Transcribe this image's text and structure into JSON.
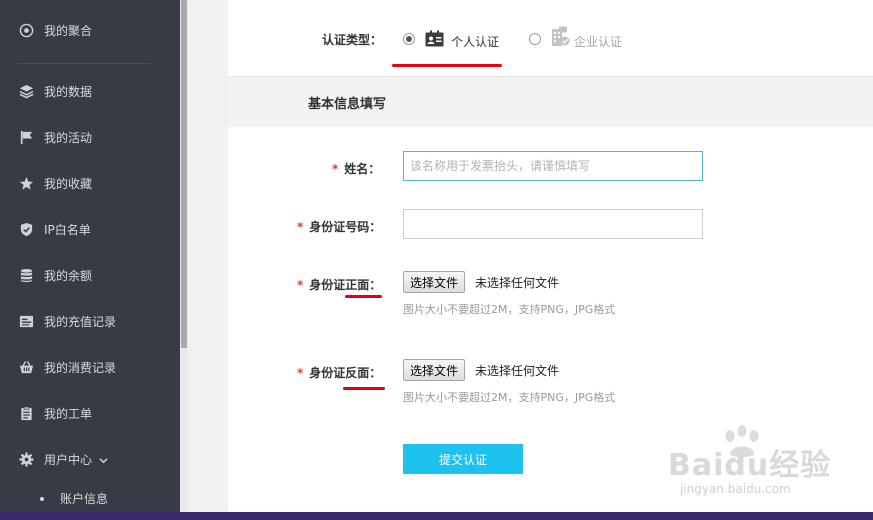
{
  "sidebar": {
    "items": [
      {
        "label": "我的聚合",
        "icon": "aggregate-icon"
      },
      {
        "label": "我的数据",
        "icon": "layers-icon"
      },
      {
        "label": "我的活动",
        "icon": "flag-icon"
      },
      {
        "label": "我的收藏",
        "icon": "star-icon"
      },
      {
        "label": "IP白名单",
        "icon": "shield-icon"
      },
      {
        "label": "我的余额",
        "icon": "database-icon"
      },
      {
        "label": "我的充值记录",
        "icon": "card-icon"
      },
      {
        "label": "我的消费记录",
        "icon": "basket-icon"
      },
      {
        "label": "我的工单",
        "icon": "clipboard-icon"
      },
      {
        "label": "用户中心",
        "icon": "gear-icon",
        "expand_icon": "chevron-down-icon"
      }
    ],
    "sub_items": [
      {
        "label": "账户信息"
      }
    ]
  },
  "form": {
    "auth_type_label": "认证类型：",
    "auth_options": [
      {
        "label": "个人认证",
        "selected": true,
        "icon": "id-card-icon"
      },
      {
        "label": "企业认证",
        "selected": false,
        "icon": "company-icon"
      }
    ],
    "section_title": "基本信息填写",
    "required_mark": "*",
    "name_label": "姓名：",
    "name_placeholder": "该名称用于发票抬头，请谨慎填写",
    "name_value": "",
    "id_number_label": "身份证号码：",
    "id_number_value": "",
    "id_front_label": "身份证正面：",
    "id_back_label": "身份证反面：",
    "file_button_label": "选择文件",
    "file_status": "未选择任何文件",
    "file_hint": "图片大小不要超过2M，支持PNG，JPG格式",
    "submit_label": "提交认证"
  },
  "watermark": {
    "main": "Baidu经验",
    "sub": "jingyan.baidu.com"
  },
  "colors": {
    "sidebar_bg": "#383b45",
    "accent": "#1ec2ef",
    "required": "#e53935",
    "annotation": "#e60012"
  }
}
